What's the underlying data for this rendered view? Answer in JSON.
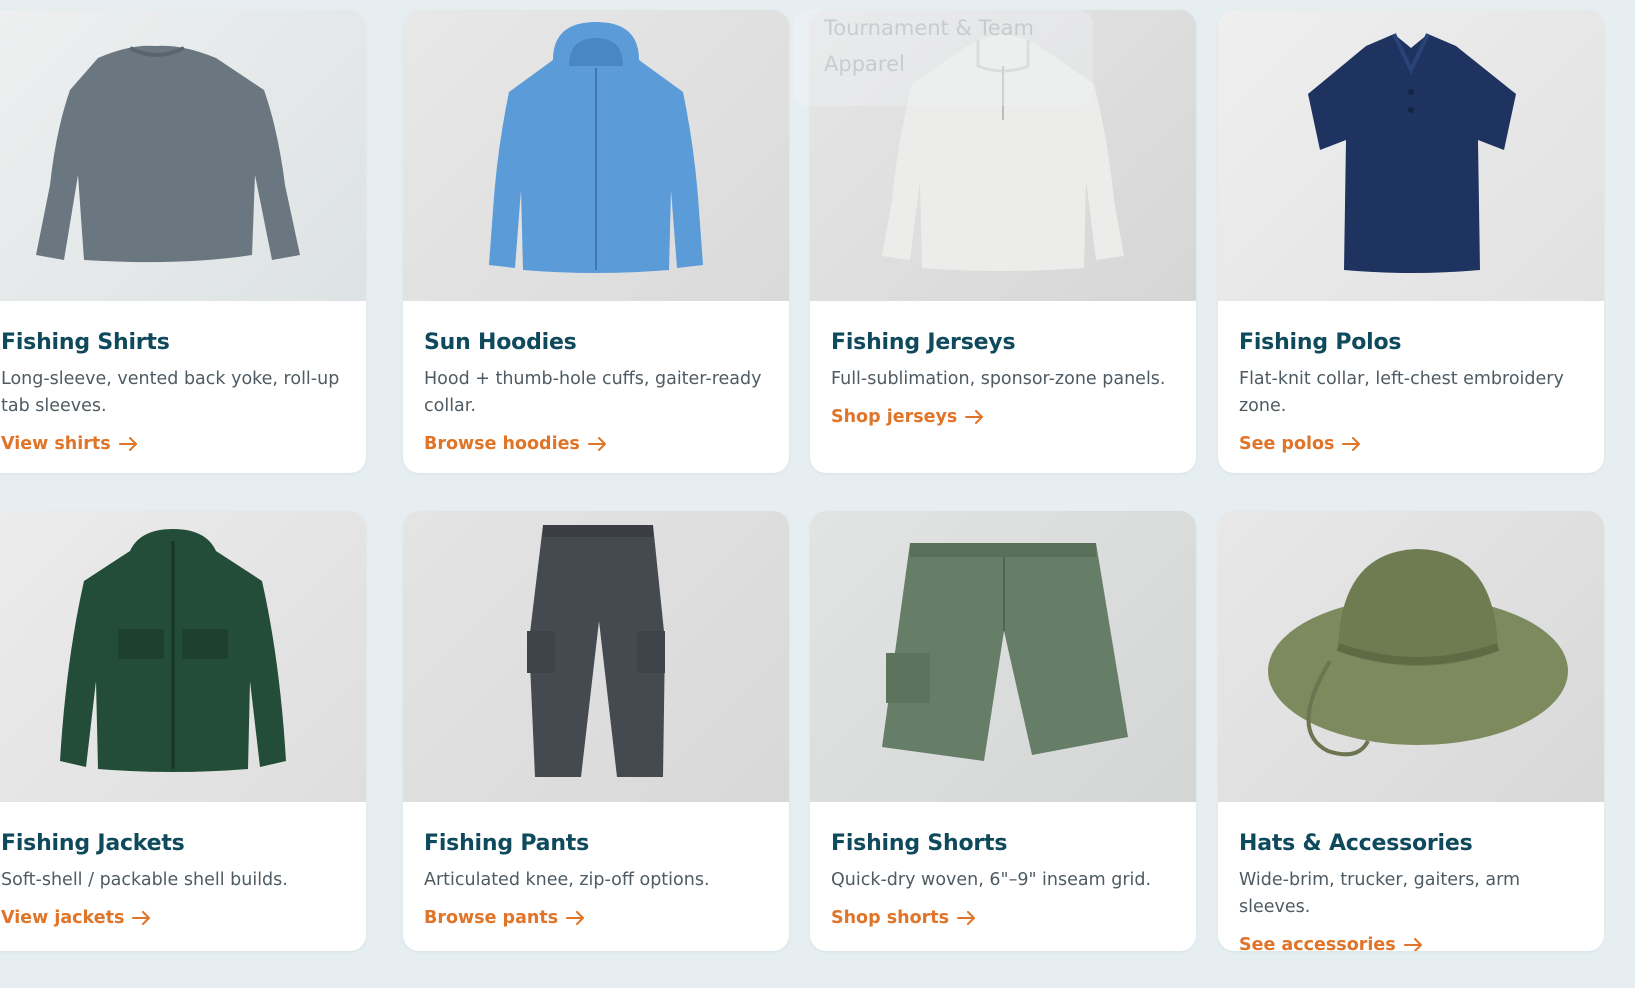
{
  "overlay": {
    "label": "Tournament & Team Apparel"
  },
  "categories": [
    {
      "title": "Fishing Shirts",
      "description": "Long-sleeve, vented back yoke, roll-up tab sleeves.",
      "cta": "View shirts",
      "image": "long-sleeve-shirt-icon",
      "color": "#6a7780"
    },
    {
      "title": "Sun Hoodies",
      "description": "Hood + thumb-hole cuffs, gaiter-ready collar.",
      "cta": "Browse hoodies",
      "image": "sun-hoodie-icon",
      "color": "#5b9bd8"
    },
    {
      "title": "Fishing Jerseys",
      "description": "Full-sublimation, sponsor-zone panels.",
      "cta": "Shop jerseys",
      "image": "jersey-icon",
      "color": "#ececea"
    },
    {
      "title": "Fishing Polos",
      "description": "Flat-knit collar, left-chest embroidery zone.",
      "cta": "See polos",
      "image": "polo-icon",
      "color": "#1e3360"
    },
    {
      "title": "Fishing Jackets",
      "description": "Soft-shell / packable shell builds.",
      "cta": "View jackets",
      "image": "jacket-icon",
      "color": "#234d38"
    },
    {
      "title": "Fishing Pants",
      "description": "Articulated knee, zip-off options.",
      "cta": "Browse pants",
      "image": "cargo-pants-icon",
      "color": "#454a50"
    },
    {
      "title": "Fishing Shorts",
      "description": "Quick-dry woven, 6\"–9\" inseam grid.",
      "cta": "Shop shorts",
      "image": "shorts-icon",
      "color": "#667d68"
    },
    {
      "title": "Hats & Accessories",
      "description": "Wide-brim, trucker, gaiters, arm sleeves.",
      "cta": "See accessories",
      "image": "bucket-hat-icon",
      "color": "#7d8a5e"
    }
  ],
  "colors": {
    "title": "#0f4a5c",
    "description": "#4f5b62",
    "cta": "#e07428",
    "page_bg": "#e6eef1"
  }
}
